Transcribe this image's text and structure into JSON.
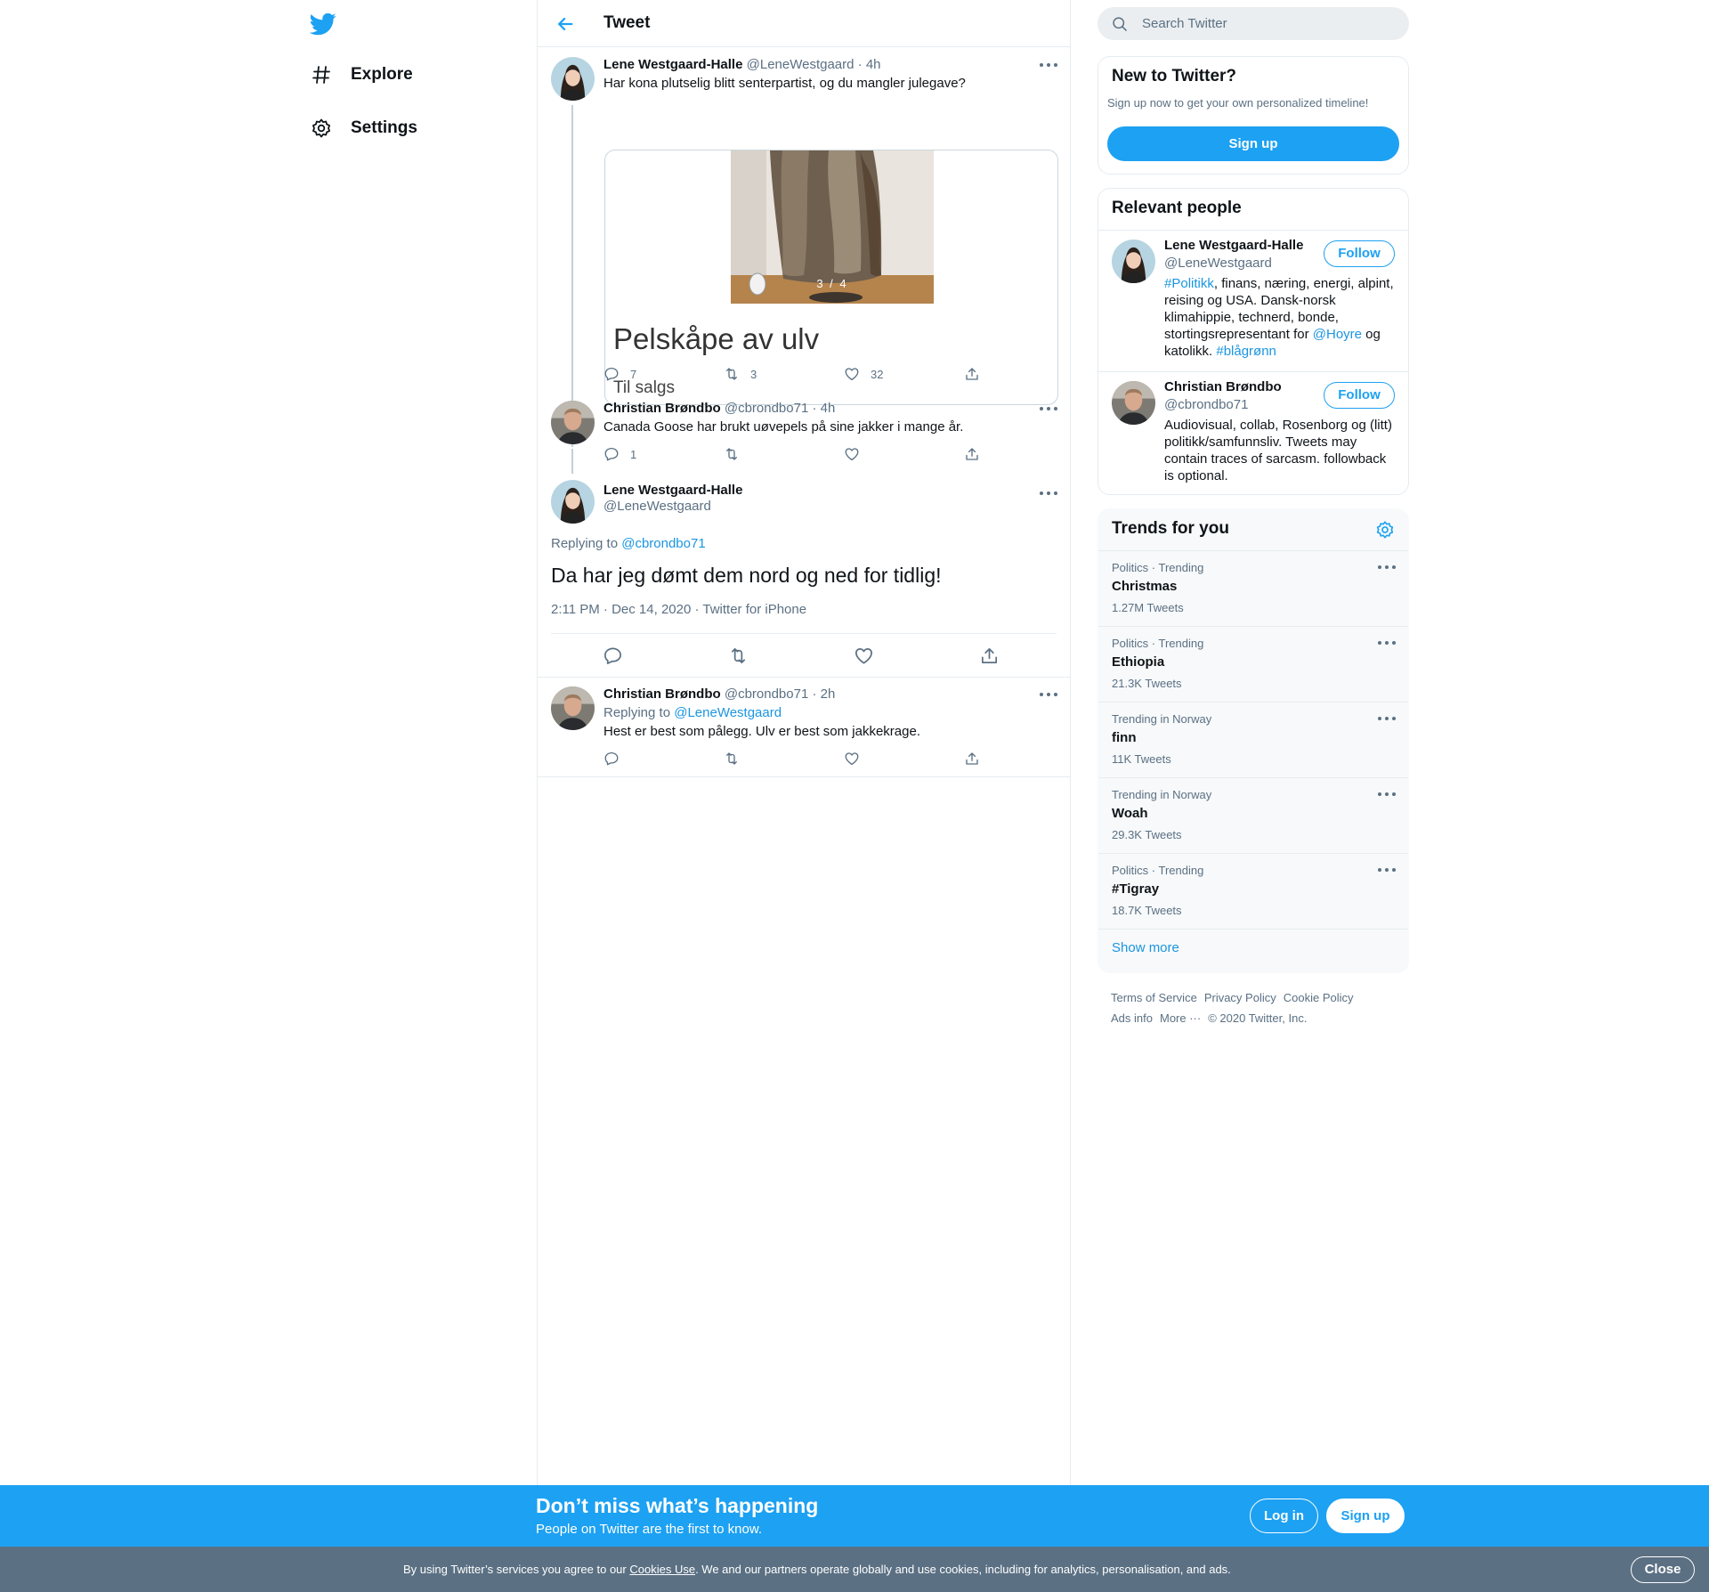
{
  "nav": {
    "items": [
      {
        "label": "Explore",
        "icon": "hashtag-icon"
      },
      {
        "label": "Settings",
        "icon": "gear-icon"
      }
    ]
  },
  "main": {
    "title": "Tweet",
    "tweets": [
      {
        "name": "Lene Westgaard-Halle",
        "handle": "@LeneWestgaard",
        "time": "· 4h",
        "text": "Har kona plutselig blitt senterpartist, og du mangler julegave?",
        "card": {
          "counter": "3 / 4",
          "title": "Pelskåpe av ulv",
          "subtitle": "Til salgs"
        },
        "replies": "7",
        "retweets": "3",
        "likes": "32"
      },
      {
        "name": "Christian Brøndbo",
        "handle": "@cbrondbo71",
        "time": "· 4h",
        "text": "Canada Goose har brukt uøvepels på sine jakker i mange år.",
        "replies": "1",
        "retweets": "",
        "likes": ""
      }
    ],
    "focal": {
      "name": "Lene Westgaard-Halle",
      "handle": "@LeneWestgaard",
      "replying_prefix": "Replying to ",
      "replying_to": "@cbrondbo71",
      "text": "Da har jeg dømt dem nord og ned for tidlig!",
      "meta": "2:11 PM · Dec 14, 2020 · Twitter for iPhone"
    },
    "reply": {
      "name": "Christian Brøndbo",
      "handle": "@cbrondbo71",
      "time": "· 2h",
      "replying_prefix": "Replying to ",
      "replying_to": "@LeneWestgaard",
      "text": "Hest er best som pålegg. Ulv er best som jakkekrage."
    }
  },
  "sidebar": {
    "search_placeholder": "Search Twitter",
    "new": {
      "title": "New to Twitter?",
      "subtitle": "Sign up now to get your own personalized timeline!",
      "signup": "Sign up"
    },
    "people": {
      "title": "Relevant people",
      "follow": "Follow",
      "list": [
        {
          "name": "Lene Westgaard-Halle",
          "handle": "@LeneWestgaard",
          "bio": {
            "tag1": "#Politikk",
            "text1": ", finans, næring, energi, alpint, reising og USA. Dansk-norsk klimahippie, technerd, bonde, stortingsrepresentant for ",
            "mention": "@Hoyre",
            "text2": " og katolikk. ",
            "tag2": "#blågrønn"
          }
        },
        {
          "name": "Christian Brøndbo",
          "handle": "@cbrondbo71",
          "bio": "Audiovisual, collab, Rosenborg og (litt) politikk/samfunnsliv. Tweets may contain traces of sarcasm. followback is optional."
        }
      ]
    },
    "trends": {
      "title": "Trends for you",
      "items": [
        {
          "meta": "Politics · Trending",
          "name": "Christmas",
          "count": "1.27M Tweets"
        },
        {
          "meta": "Politics · Trending",
          "name": "Ethiopia",
          "count": "21.3K Tweets"
        },
        {
          "meta": "Trending in Norway",
          "name": "finn",
          "count": "11K Tweets"
        },
        {
          "meta": "Trending in Norway",
          "name": "Woah",
          "count": "29.3K Tweets"
        },
        {
          "meta": "Politics · Trending",
          "name": "#Tigray",
          "count": "18.7K Tweets"
        }
      ],
      "show_more": "Show more"
    },
    "footer": {
      "links": [
        "Terms of Service",
        "Privacy Policy",
        "Cookie Policy",
        "Ads info",
        "More ···"
      ],
      "copyright": "© 2020 Twitter, Inc."
    }
  },
  "banner": {
    "title": "Don’t miss what’s happening",
    "subtitle": "People on Twitter are the first to know.",
    "login": "Log in",
    "signup": "Sign up"
  },
  "cookies": {
    "text_before": "By using Twitter’s services you agree to our ",
    "link": "Cookies Use",
    "text_after": ". We and our partners operate globally and use cookies, including for analytics, personalisation, and ads.",
    "close": "Close"
  },
  "colors": {
    "brand": "#1da1f2",
    "link": "#1b95e0",
    "muted": "#5b7083",
    "border": "#e6ecf0",
    "cookie_bar": "#5b7083"
  }
}
